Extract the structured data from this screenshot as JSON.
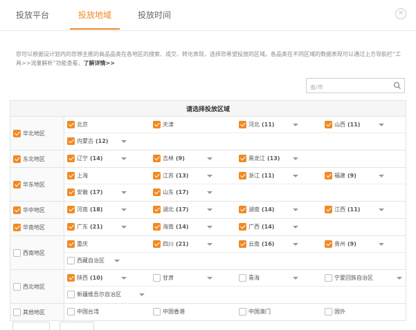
{
  "tabs": [
    {
      "label": "投放平台",
      "active": false
    },
    {
      "label": "投放地域",
      "active": true
    },
    {
      "label": "投放时间",
      "active": false
    }
  ],
  "close_icon": "close-circle-icon",
  "accent_color": "#f08a24",
  "description": {
    "text": "您可以根据设计划内的您想主推的商品品类在各地区的搜索、成交、转化表现，选择您希望投放的区域。各品类在不同区域的数据表现可以通过上方导航栏“工具>>流量解析”功能查看，",
    "link": "了解详情>>"
  },
  "search": {
    "placeholder": "省/市",
    "icon": "search-icon"
  },
  "table_header": "请选择投放区域",
  "regions": [
    {
      "name": "华北地区",
      "checked": true,
      "rows": [
        [
          {
            "name": "北京",
            "checked": true
          },
          {
            "name": "天津",
            "checked": true
          },
          {
            "name": "河北",
            "count": "(11)",
            "checked": true,
            "dropdown": true
          },
          {
            "name": "山西",
            "count": "(11)",
            "checked": true,
            "dropdown": true
          }
        ],
        [
          {
            "name": "内蒙古",
            "count": "(12)",
            "checked": true,
            "dropdown": true
          }
        ]
      ]
    },
    {
      "name": "东北地区",
      "checked": true,
      "rows": [
        [
          {
            "name": "辽宁",
            "count": "(14)",
            "checked": true,
            "dropdown": true
          },
          {
            "name": "吉林",
            "count": "(9)",
            "checked": true,
            "dropdown": true
          },
          {
            "name": "黑龙江",
            "count": "(13)",
            "checked": true,
            "dropdown": true
          }
        ]
      ]
    },
    {
      "name": "华东地区",
      "checked": true,
      "rows": [
        [
          {
            "name": "上海",
            "checked": true
          },
          {
            "name": "江苏",
            "count": "(13)",
            "checked": true,
            "dropdown": true
          },
          {
            "name": "浙江",
            "count": "(11)",
            "checked": true,
            "dropdown": true
          },
          {
            "name": "福建",
            "count": "(9)",
            "checked": true,
            "dropdown": true
          }
        ],
        [
          {
            "name": "安徽",
            "count": "(17)",
            "checked": true,
            "dropdown": true
          },
          {
            "name": "山东",
            "count": "(17)",
            "checked": true,
            "dropdown": true
          }
        ]
      ]
    },
    {
      "name": "华中地区",
      "checked": true,
      "rows": [
        [
          {
            "name": "河南",
            "count": "(18)",
            "checked": true,
            "dropdown": true
          },
          {
            "name": "湖北",
            "count": "(17)",
            "checked": true,
            "dropdown": true
          },
          {
            "name": "湖南",
            "count": "(14)",
            "checked": true,
            "dropdown": true
          },
          {
            "name": "江西",
            "count": "(11)",
            "checked": true,
            "dropdown": true
          }
        ]
      ]
    },
    {
      "name": "华南地区",
      "checked": true,
      "rows": [
        [
          {
            "name": "广东",
            "count": "(21)",
            "checked": true,
            "dropdown": true
          },
          {
            "name": "海南",
            "count": "(14)",
            "checked": true,
            "dropdown": true
          },
          {
            "name": "广西",
            "count": "(14)",
            "checked": true,
            "dropdown": true
          }
        ]
      ]
    },
    {
      "name": "西南地区",
      "checked": false,
      "rows": [
        [
          {
            "name": "重庆",
            "checked": true
          },
          {
            "name": "四川",
            "count": "(21)",
            "checked": true,
            "dropdown": true
          },
          {
            "name": "云南",
            "count": "(16)",
            "checked": true,
            "dropdown": true
          },
          {
            "name": "贵州",
            "count": "(9)",
            "checked": true,
            "dropdown": true
          }
        ],
        [
          {
            "name": "西藏自治区",
            "checked": false,
            "dropdown": true
          }
        ]
      ]
    },
    {
      "name": "西北地区",
      "checked": false,
      "rows": [
        [
          {
            "name": "陕西",
            "count": "(10)",
            "checked": true,
            "dropdown": true
          },
          {
            "name": "甘肃",
            "checked": false,
            "dropdown": true
          },
          {
            "name": "青海",
            "checked": false,
            "dropdown": true
          },
          {
            "name": "宁夏回族自治区",
            "checked": false,
            "dropdown": true
          }
        ],
        [
          {
            "name": "新疆维吾尔自治区",
            "checked": false,
            "dropdown": true
          }
        ]
      ]
    },
    {
      "name": "其他地区",
      "checked": false,
      "rows": [
        [
          {
            "name": "中国台湾",
            "checked": false
          },
          {
            "name": "中国香港",
            "checked": false
          },
          {
            "name": "中国澳门",
            "checked": false
          },
          {
            "name": "国外",
            "checked": false
          }
        ]
      ]
    }
  ]
}
